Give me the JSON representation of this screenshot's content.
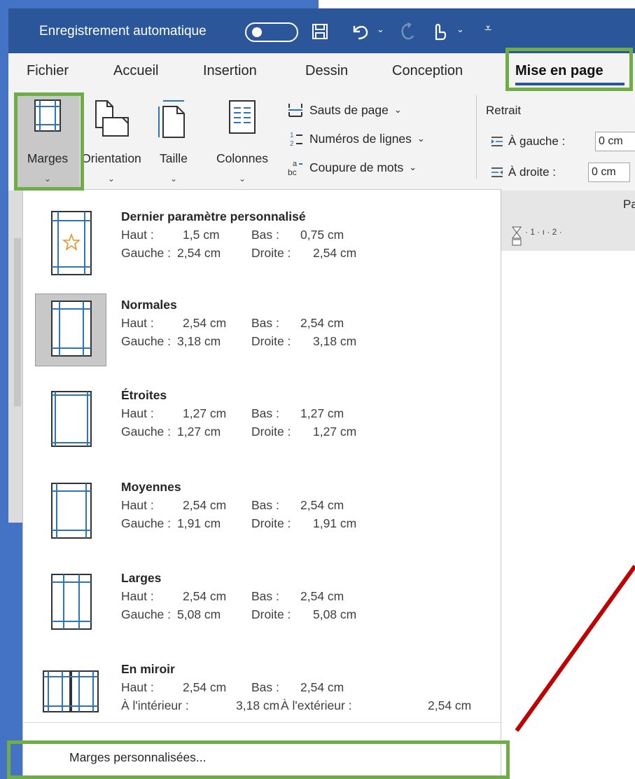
{
  "titlebar": {
    "autosave_label": "Enregistrement automatique",
    "icons": [
      "toggle-off",
      "save-icon",
      "undo-icon",
      "redo-icon",
      "touch-mode-icon",
      "customize-qat-icon"
    ]
  },
  "tabs": [
    {
      "label": "Fichier"
    },
    {
      "label": "Accueil"
    },
    {
      "label": "Insertion"
    },
    {
      "label": "Dessin"
    },
    {
      "label": "Conception"
    },
    {
      "label": "Mise en page",
      "active": true
    }
  ],
  "ribbon": {
    "margins_label": "Marges",
    "orientation_label": "Orientation",
    "size_label": "Taille",
    "columns_label": "Colonnes",
    "breaks_label": "Sauts de page",
    "line_numbers_label": "Numéros de lignes",
    "hyphenation_label": "Coupure de mots",
    "indent_group_label": "Retrait",
    "indent_left_label": "À gauche :",
    "indent_left_value": "0 cm",
    "indent_right_label": "À droite :",
    "indent_right_value": "0 cm",
    "paragraph_partial_label": "Pa"
  },
  "ruler": {
    "text": "· 1 · ı · 2 ·"
  },
  "margins_menu": {
    "items": [
      {
        "name": "Dernier paramètre personnalisé",
        "top_label": "Haut :",
        "top": "1,5 cm",
        "bottom_label": "Bas :",
        "bottom": "0,75 cm",
        "left_label": "Gauche :",
        "left": "2,54 cm",
        "right_label": "Droite :",
        "right": "2,54 cm"
      },
      {
        "name": "Normales",
        "top_label": "Haut :",
        "top": "2,54 cm",
        "bottom_label": "Bas :",
        "bottom": "2,54 cm",
        "left_label": "Gauche :",
        "left": "3,18 cm",
        "right_label": "Droite :",
        "right": "3,18 cm",
        "selected": true
      },
      {
        "name": "Étroites",
        "top_label": "Haut :",
        "top": "1,27 cm",
        "bottom_label": "Bas :",
        "bottom": "1,27 cm",
        "left_label": "Gauche :",
        "left": "1,27 cm",
        "right_label": "Droite :",
        "right": "1,27 cm"
      },
      {
        "name": "Moyennes",
        "top_label": "Haut :",
        "top": "2,54 cm",
        "bottom_label": "Bas :",
        "bottom": "2,54 cm",
        "left_label": "Gauche :",
        "left": "1,91 cm",
        "right_label": "Droite :",
        "right": "1,91 cm"
      },
      {
        "name": "Larges",
        "top_label": "Haut :",
        "top": "2,54 cm",
        "bottom_label": "Bas :",
        "bottom": "2,54 cm",
        "left_label": "Gauche :",
        "left": "5,08 cm",
        "right_label": "Droite :",
        "right": "5,08 cm"
      },
      {
        "name": "En miroir",
        "top_label": "Haut :",
        "top": "2,54 cm",
        "bottom_label": "Bas :",
        "bottom": "2,54 cm",
        "left_label": "À l'intérieur :",
        "left": "3,18 cm",
        "right_label": "À l'extérieur :",
        "right": "2,54 cm"
      }
    ],
    "custom_margins_label": "Marges personnalisées..."
  },
  "colors": {
    "title_bar": "#2b579a",
    "highlight_box": "#70ad47",
    "arrow": "#c00000",
    "backdrop": "#4472c4"
  }
}
